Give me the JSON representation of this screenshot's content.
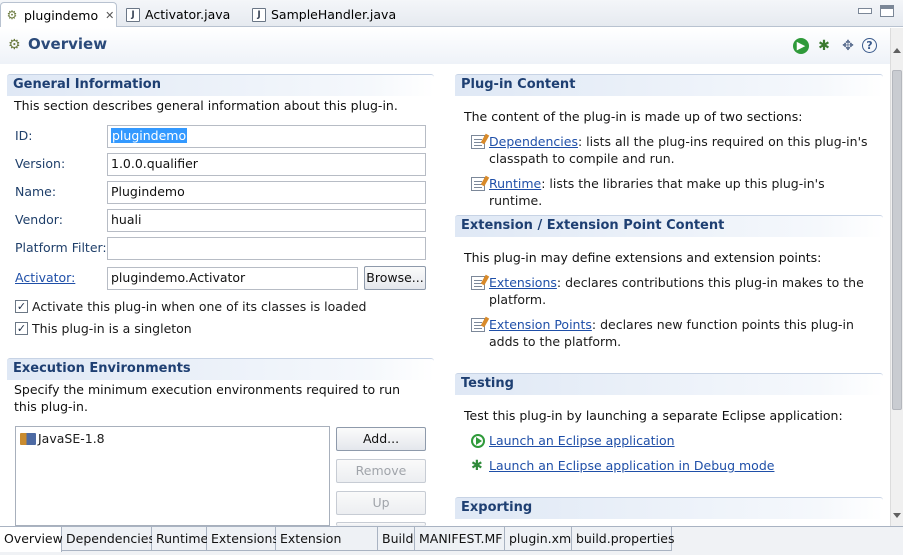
{
  "editor_tabs": [
    {
      "label": "plugindemo",
      "icon": "plugin-icon"
    },
    {
      "label": "Activator.java",
      "icon": "java-file-icon"
    },
    {
      "label": "SampleHandler.java",
      "icon": "java-file-icon"
    }
  ],
  "header": {
    "title": "Overview"
  },
  "general": {
    "title": "General Information",
    "description": "This section describes general information about this plug-in.",
    "id_label": "ID:",
    "id_value": "plugindemo",
    "version_label": "Version:",
    "version_value": "1.0.0.qualifier",
    "name_label": "Name:",
    "name_value": "Plugindemo",
    "vendor_label": "Vendor:",
    "vendor_value": "huali",
    "platform_filter_label": "Platform Filter:",
    "platform_filter_value": "",
    "activator_label": "Activator:",
    "activator_value": "plugindemo.Activator",
    "browse_label": "Browse...",
    "activate_checkbox": "Activate this plug-in when one of its classes is loaded",
    "activate_checked": true,
    "singleton_checkbox": "This plug-in is a singleton",
    "singleton_checked": true
  },
  "execution": {
    "title": "Execution Environments",
    "description": "Specify the minimum execution environments required to run this plug-in.",
    "environments": [
      "JavaSE-1.8"
    ],
    "add_label": "Add...",
    "remove_label": "Remove",
    "up_label": "Up"
  },
  "plugin_content": {
    "title": "Plug-in Content",
    "description": "The content of the plug-in is made up of two sections:",
    "items": [
      {
        "link": "Dependencies",
        "text": ": lists all the plug-ins required on this plug-in's classpath to compile and run."
      },
      {
        "link": "Runtime",
        "text": ": lists the libraries that make up this plug-in's runtime."
      }
    ]
  },
  "extension_content": {
    "title": "Extension / Extension Point Content",
    "description": "This plug-in may define extensions and extension points:",
    "items": [
      {
        "link": "Extensions",
        "text": ": declares contributions this plug-in makes to the platform."
      },
      {
        "link": "Extension Points",
        "text": ": declares new function points this plug-in adds to the platform."
      }
    ]
  },
  "testing": {
    "title": "Testing",
    "description": "Test this plug-in by launching a separate Eclipse application:",
    "launch_link": "Launch an Eclipse application",
    "debug_link": "Launch an Eclipse application in Debug mode"
  },
  "exporting": {
    "title": "Exporting"
  },
  "bottom_tabs": [
    "Overview",
    "Dependencies",
    "Runtime",
    "Extensions",
    "Extension Points",
    "Build",
    "MANIFEST.MF",
    "plugin.xml",
    "build.properties"
  ]
}
